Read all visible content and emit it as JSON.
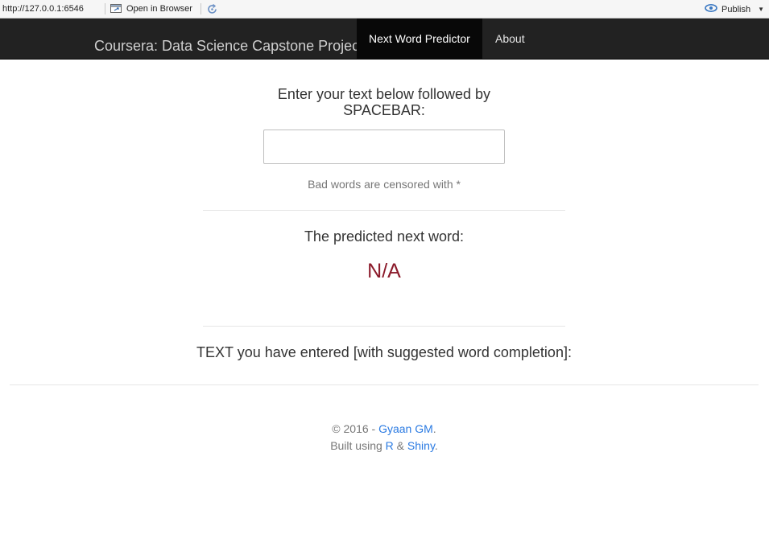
{
  "viewer": {
    "url": "http://127.0.0.1:6546",
    "open_in_browser": "Open in Browser",
    "publish": "Publish"
  },
  "navbar": {
    "brand": "Coursera: Data Science Capstone Project",
    "tabs": [
      {
        "label": "Next Word Predictor",
        "active": true
      },
      {
        "label": "About",
        "active": false
      }
    ]
  },
  "main": {
    "prompt_line1": "Enter your text below followed by",
    "prompt_line2": "SPACEBAR:",
    "input_value": "",
    "censor_note": "Bad words are censored with *",
    "predicted_label": "The predicted next word:",
    "predicted_value": "N/A",
    "entered_label": "TEXT you have entered [with suggested word completion]:"
  },
  "footer": {
    "copyright": "© 2016 - ",
    "author": "Gyaan GM",
    "author_suffix": ".",
    "built_using": "Built using ",
    "link_r": "R",
    "ampersand": " & ",
    "link_shiny": "Shiny",
    "end": "."
  },
  "colors": {
    "navbar_bg": "#222222",
    "active_tab_bg": "#080808",
    "prediction": "#8b1a2a",
    "link": "#2a7ae2"
  }
}
